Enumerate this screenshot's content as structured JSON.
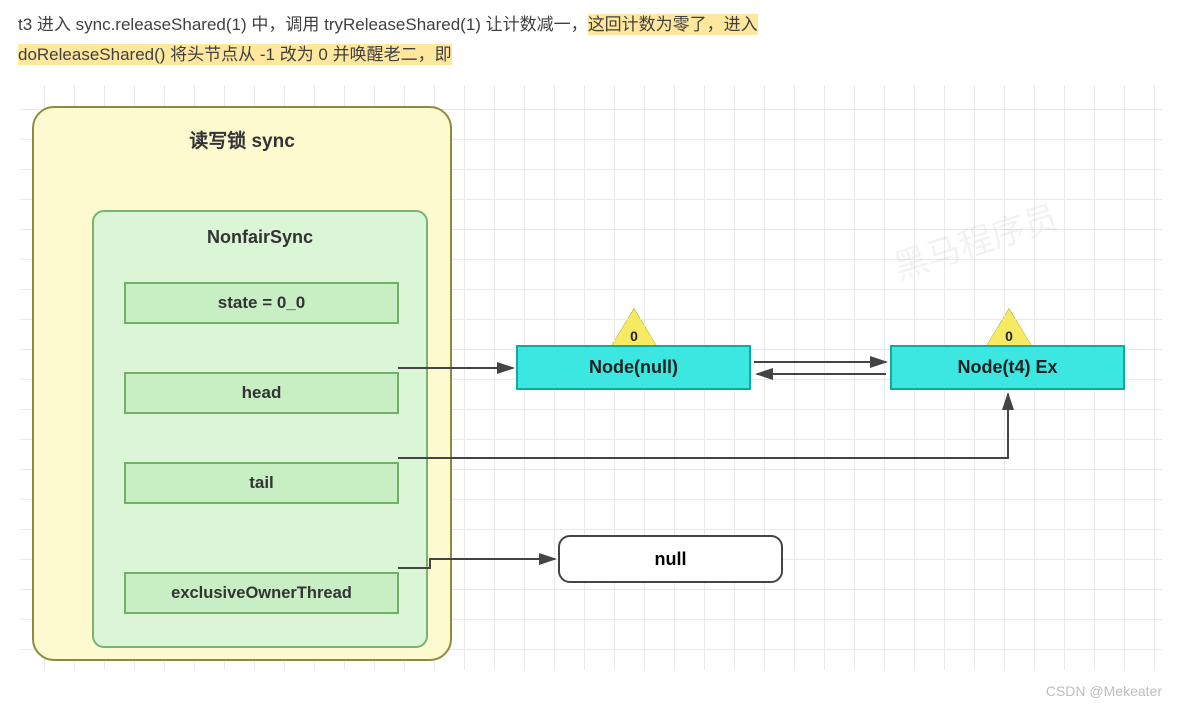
{
  "header": {
    "prefix": "t3 进入 sync.releaseShared(1) 中，调用 tryReleaseShared(1) 让计数减一，",
    "hl1": "这回计数为零了，进入",
    "line2a": "doReleaseShared() 将头节点从 -1 改为 0 并唤醒老二，即"
  },
  "diagram": {
    "outer_title": "读写锁 sync",
    "inner_title": "NonfairSync",
    "state_label": "state = 0_0",
    "head_label": "head",
    "tail_label": "tail",
    "eot_label": "exclusiveOwnerThread",
    "node1_label": "Node(null)",
    "node1_ws": "0",
    "node2_label": "Node(t4) Ex",
    "node2_ws": "0",
    "null_label": "null"
  },
  "watermark": "CSDN @Mekeater",
  "bg_watermark": "黑马程序员"
}
